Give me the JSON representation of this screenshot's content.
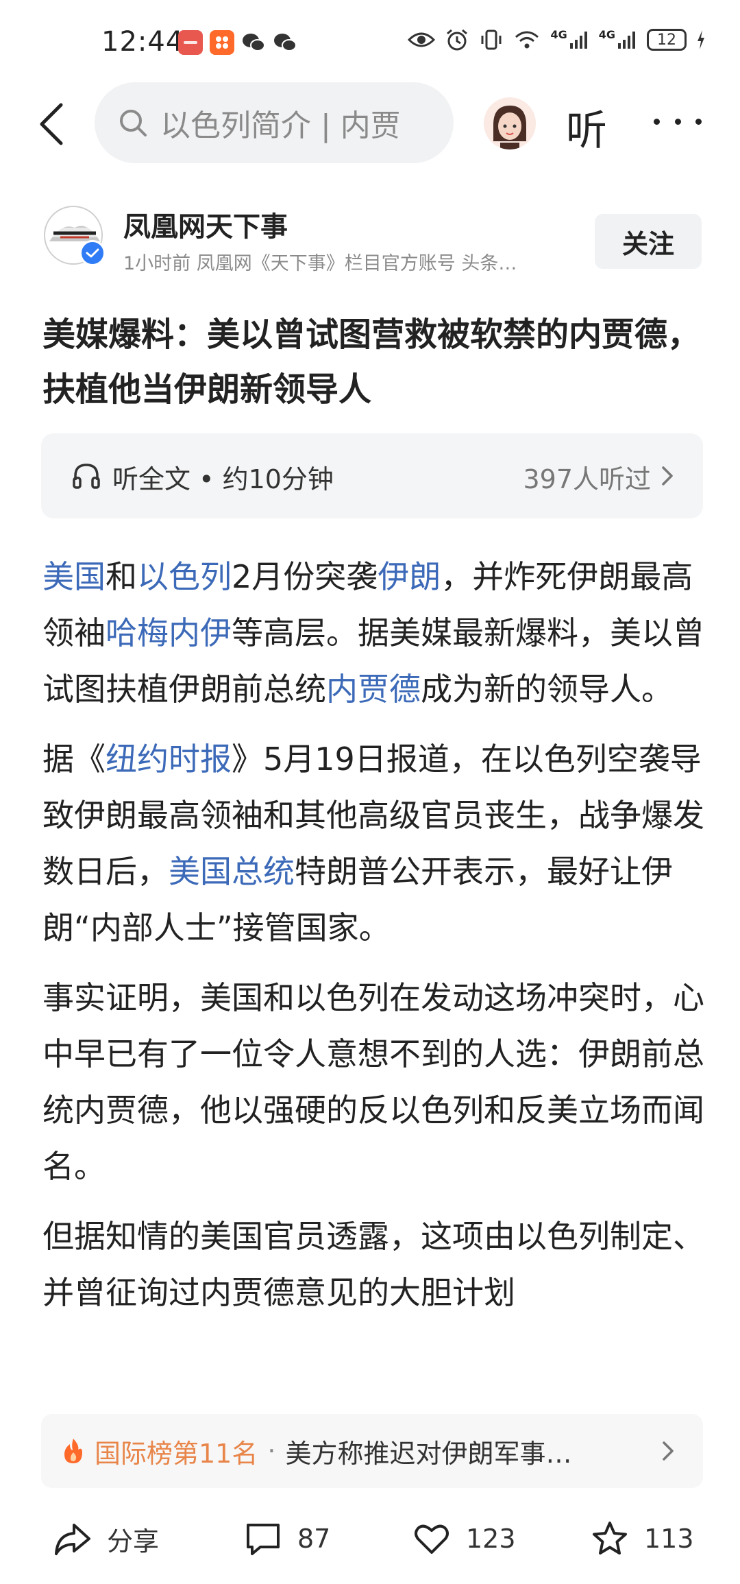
{
  "status_bar": {
    "time": "12:44",
    "network_1": "4G",
    "network_2": "4G",
    "battery": "12"
  },
  "top_nav": {
    "search_placeholder": "以色列简介 | 内贾",
    "listen_label": "听"
  },
  "author": {
    "name": "凤凰网天下事",
    "meta": "1小时前  凤凰网《天下事》栏目官方账号 头条…",
    "follow_label": "关注"
  },
  "article": {
    "title": "美媒爆料：美以曾试图营救被软禁的内贾德，扶植他当伊朗新领导人",
    "listen_full": "听全文 • 约10分钟",
    "listen_count": "397人听过",
    "paragraphs": [
      [
        {
          "text": "美国",
          "link": true
        },
        {
          "text": "和",
          "link": false
        },
        {
          "text": "以色列",
          "link": true
        },
        {
          "text": "2月份突袭",
          "link": false
        },
        {
          "text": "伊朗",
          "link": true
        },
        {
          "text": "，并炸死伊朗最高领袖",
          "link": false
        },
        {
          "text": "哈梅内伊",
          "link": true
        },
        {
          "text": "等高层。据美媒最新爆料，美以曾试图扶植伊朗前总统",
          "link": false
        },
        {
          "text": "内贾德",
          "link": true
        },
        {
          "text": "成为新的领导人。",
          "link": false
        }
      ],
      [
        {
          "text": "据《",
          "link": false
        },
        {
          "text": "纽约时报",
          "link": true
        },
        {
          "text": "》5月19日报道，在以色列空袭导致伊朗最高领袖和其他高级官员丧生，战争爆发数日后，",
          "link": false
        },
        {
          "text": "美国总统",
          "link": true
        },
        {
          "text": "特朗普公开表示，最好让伊朗“内部人士”接管国家。",
          "link": false
        }
      ],
      [
        {
          "text": "事实证明，美国和以色列在发动这场冲突时，心中早已有了一位令人意想不到的人选：伊朗前总统内贾德，他以强硬的反以色列和反美立场而闻名。",
          "link": false
        }
      ],
      [
        {
          "text": "但据知情的美国官员透露，这项由以色列制定、并曾征询过内贾德意见的大胆计划",
          "link": false
        }
      ]
    ]
  },
  "hot_rank": {
    "rank_label": "国际榜第11名",
    "separator": "·",
    "headline": "美方称推迟对伊朗军事…"
  },
  "bottom_bar": {
    "share_label": "分享",
    "comments": "87",
    "likes": "123",
    "favorites": "113"
  },
  "colors": {
    "link": "#3c6ab8",
    "rank_orange": "#e8864a",
    "verified_blue": "#2f7cf6"
  }
}
